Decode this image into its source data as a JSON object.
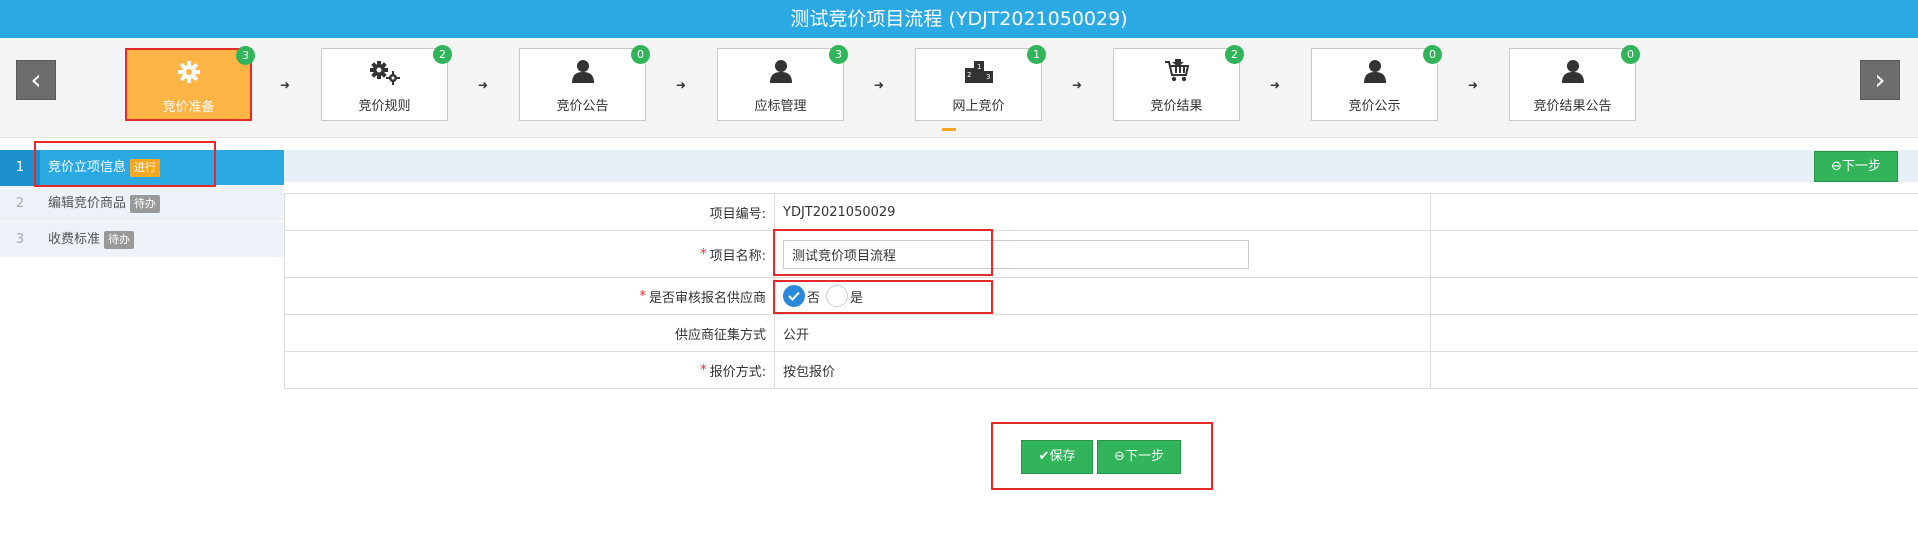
{
  "title": "测试竞价项目流程 (YDJT2021050029)",
  "nav": {
    "prev": "‹",
    "next": "›"
  },
  "steps": [
    {
      "label": "竞价准备",
      "count": "3",
      "icon": "gear-icon"
    },
    {
      "label": "竞价规则",
      "count": "2",
      "icon": "gears-icon"
    },
    {
      "label": "竞价公告",
      "count": "0",
      "icon": "user-icon"
    },
    {
      "label": "应标管理",
      "count": "3",
      "icon": "user-icon"
    },
    {
      "label": "网上竞价",
      "count": "1",
      "icon": "podium-icon"
    },
    {
      "label": "竞价结果",
      "count": "2",
      "icon": "cart-icon"
    },
    {
      "label": "竞价公示",
      "count": "0",
      "icon": "user-icon"
    },
    {
      "label": "竞价结果公告",
      "count": "0",
      "icon": "user-icon"
    }
  ],
  "leftnav": [
    {
      "num": "1",
      "label": "竞价立项信息",
      "tag": "进行"
    },
    {
      "num": "2",
      "label": "编辑竞价商品",
      "tag": "待办"
    },
    {
      "num": "3",
      "label": "收费标准",
      "tag": "待办"
    }
  ],
  "buttons": {
    "next": "下一步",
    "save": "保存"
  },
  "form": {
    "project_no_label": "项目编号:",
    "project_no": "YDJT2021050029",
    "project_name_label": "项目名称:",
    "project_name": "测试竞价项目流程",
    "audit_label": "是否审核报名供应商",
    "audit_no": "否",
    "audit_yes": "是",
    "supplier_method_label": "供应商征集方式",
    "supplier_method": "公开",
    "quote_method_label": "报价方式:",
    "quote_method": "按包报价"
  },
  "colors": {
    "header": "#2aa9e3",
    "active_step": "#ffb446",
    "badge": "#32b55a",
    "button": "#32b55a",
    "highlight": "#e52a2a"
  }
}
